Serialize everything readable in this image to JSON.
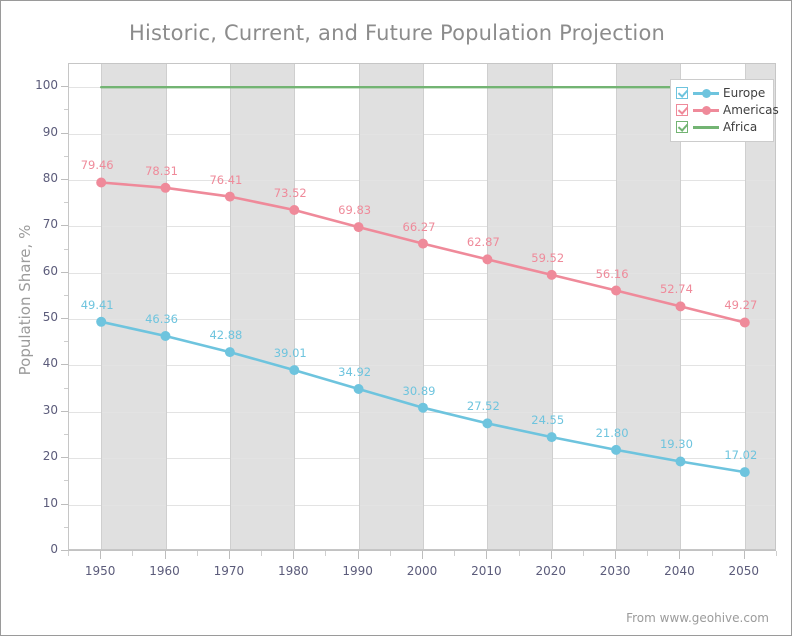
{
  "chart_data": {
    "type": "line",
    "title": "Historic, Current, and Future Population Projection",
    "xlabel": "",
    "ylabel": "Population Share, %",
    "categories": [
      1950,
      1960,
      1970,
      1980,
      1990,
      2000,
      2010,
      2020,
      2030,
      2040,
      2050
    ],
    "xlim": [
      1945,
      2055
    ],
    "ylim": [
      0,
      105
    ],
    "y_ticks": [
      0,
      10,
      20,
      30,
      40,
      50,
      60,
      70,
      80,
      90,
      100
    ],
    "x_ticks": [
      1950,
      1960,
      1970,
      1980,
      1990,
      2000,
      2010,
      2020,
      2030,
      2040,
      2050
    ],
    "grid": true,
    "legend_position": "top-right",
    "series": [
      {
        "name": "Europe",
        "color": "#6ec4de",
        "marker": "circle",
        "values": [
          49.41,
          46.36,
          42.88,
          39.01,
          34.92,
          30.89,
          27.52,
          24.55,
          21.8,
          19.3,
          17.02
        ],
        "labels": [
          "49.41",
          "46.36",
          "42.88",
          "39.01",
          "34.92",
          "30.89",
          "27.52",
          "24.55",
          "21.80",
          "19.30",
          "17.02"
        ]
      },
      {
        "name": "Americas",
        "color": "#ef8a9a",
        "marker": "circle",
        "values": [
          79.46,
          78.31,
          76.41,
          73.52,
          69.83,
          66.27,
          62.87,
          59.52,
          56.16,
          52.74,
          49.27
        ],
        "labels": [
          "79.46",
          "78.31",
          "76.41",
          "73.52",
          "69.83",
          "66.27",
          "62.87",
          "59.52",
          "56.16",
          "52.74",
          "49.27"
        ]
      },
      {
        "name": "Africa",
        "color": "#73b473",
        "marker": "none",
        "values": [
          100,
          100,
          100,
          100,
          100,
          100,
          100,
          100,
          100,
          100,
          100
        ],
        "labels": []
      }
    ],
    "shaded_bands": [
      [
        1950,
        1960
      ],
      [
        1970,
        1980
      ],
      [
        1990,
        2000
      ],
      [
        2010,
        2020
      ],
      [
        2030,
        2040
      ],
      [
        2050,
        2055
      ]
    ],
    "band_color": "#e0e0e0"
  },
  "legend": {
    "items": [
      {
        "label": "Europe",
        "color": "#6ec4de",
        "checked": true
      },
      {
        "label": "Americas",
        "color": "#ef8a9a",
        "checked": true
      },
      {
        "label": "Africa",
        "color": "#73b473",
        "checked": true
      }
    ]
  },
  "footer": {
    "credit": "From www.geohive.com"
  }
}
